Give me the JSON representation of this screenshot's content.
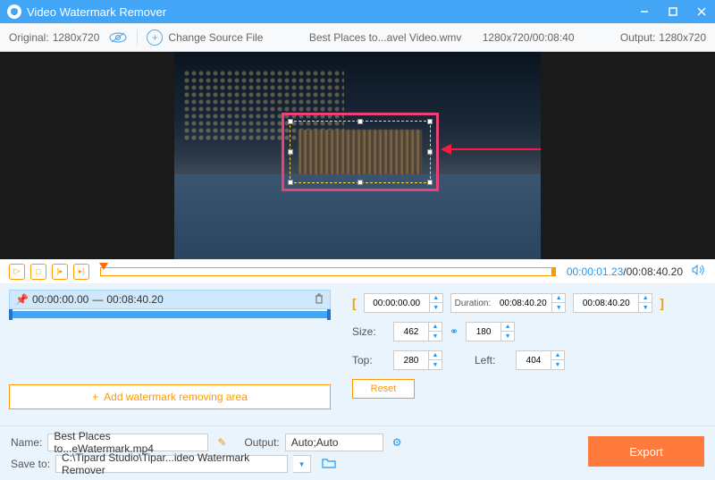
{
  "titlebar": {
    "app_name": "Video Watermark Remover"
  },
  "toolbar": {
    "original_label": "Original:",
    "original_res": "1280x720",
    "change_source": "Change Source File",
    "filename": "Best Places to...avel Video.wmv",
    "res_duration": "1280x720/00:08:40",
    "output_label": "Output:",
    "output_res": "1280x720"
  },
  "playback": {
    "current": "00:00:01.23",
    "total": "00:08:40.20"
  },
  "segment": {
    "start": "00:00:00.00",
    "end": "00:08:40.20",
    "separator": "—"
  },
  "add_area": "Add watermark removing area",
  "range": {
    "start": "00:00:00.00",
    "duration_label": "Duration:",
    "duration": "00:08:40.20",
    "end": "00:08:40.20"
  },
  "size": {
    "label": "Size:",
    "w": "462",
    "h": "180"
  },
  "pos": {
    "top_label": "Top:",
    "top": "280",
    "left_label": "Left:",
    "left": "404"
  },
  "reset": "Reset",
  "bottom": {
    "name_label": "Name:",
    "name": "Best Places to...eWatermark.mp4",
    "output_label": "Output:",
    "output": "Auto;Auto",
    "saveto_label": "Save to:",
    "saveto": "C:\\Tipard Studio\\Tipar...ideo Watermark Remover",
    "export": "Export"
  }
}
